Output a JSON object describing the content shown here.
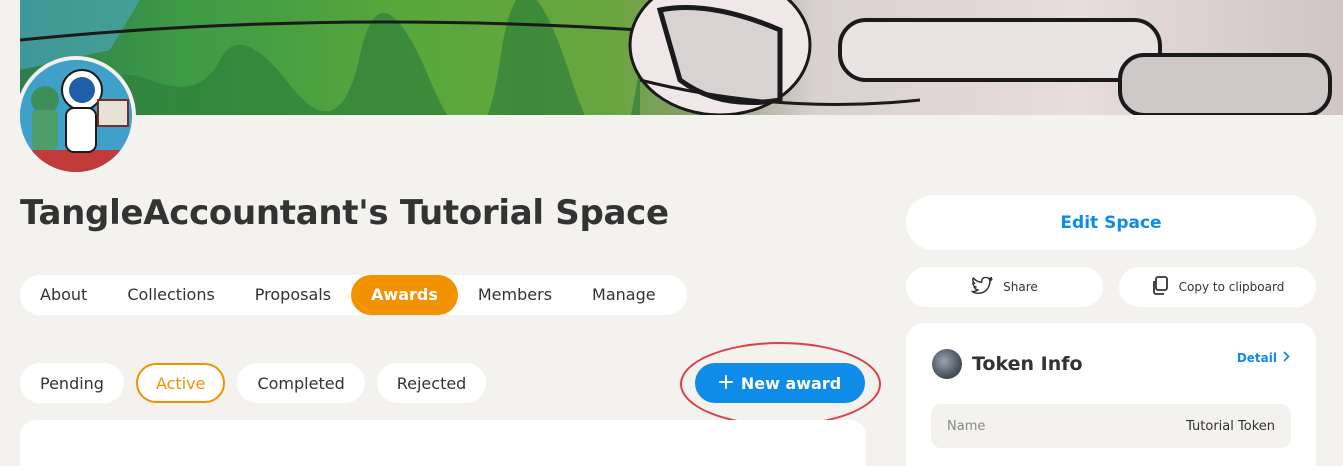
{
  "space": {
    "title": "TangleAccountant's Tutorial Space"
  },
  "tabs": [
    {
      "label": "About"
    },
    {
      "label": "Collections"
    },
    {
      "label": "Proposals"
    },
    {
      "label": "Awards",
      "active": true
    },
    {
      "label": "Members"
    },
    {
      "label": "Manage"
    }
  ],
  "filters": [
    {
      "label": "Pending"
    },
    {
      "label": "Active",
      "active": true
    },
    {
      "label": "Completed"
    },
    {
      "label": "Rejected"
    }
  ],
  "actions": {
    "new_award": "New award",
    "edit_space": "Edit Space",
    "share": "Share",
    "copy": "Copy to clipboard"
  },
  "token_info": {
    "title": "Token Info",
    "detail": "Detail",
    "rows": [
      {
        "label": "Name",
        "value": "Tutorial Token"
      }
    ]
  },
  "colors": {
    "accent_orange": "#f39200",
    "primary_blue": "#0f8be8",
    "highlight_red": "#d9414a",
    "background": "#f3f2ee"
  },
  "icons": [
    "plus-icon",
    "twitter-icon",
    "copy-icon",
    "chevron-right-icon"
  ]
}
